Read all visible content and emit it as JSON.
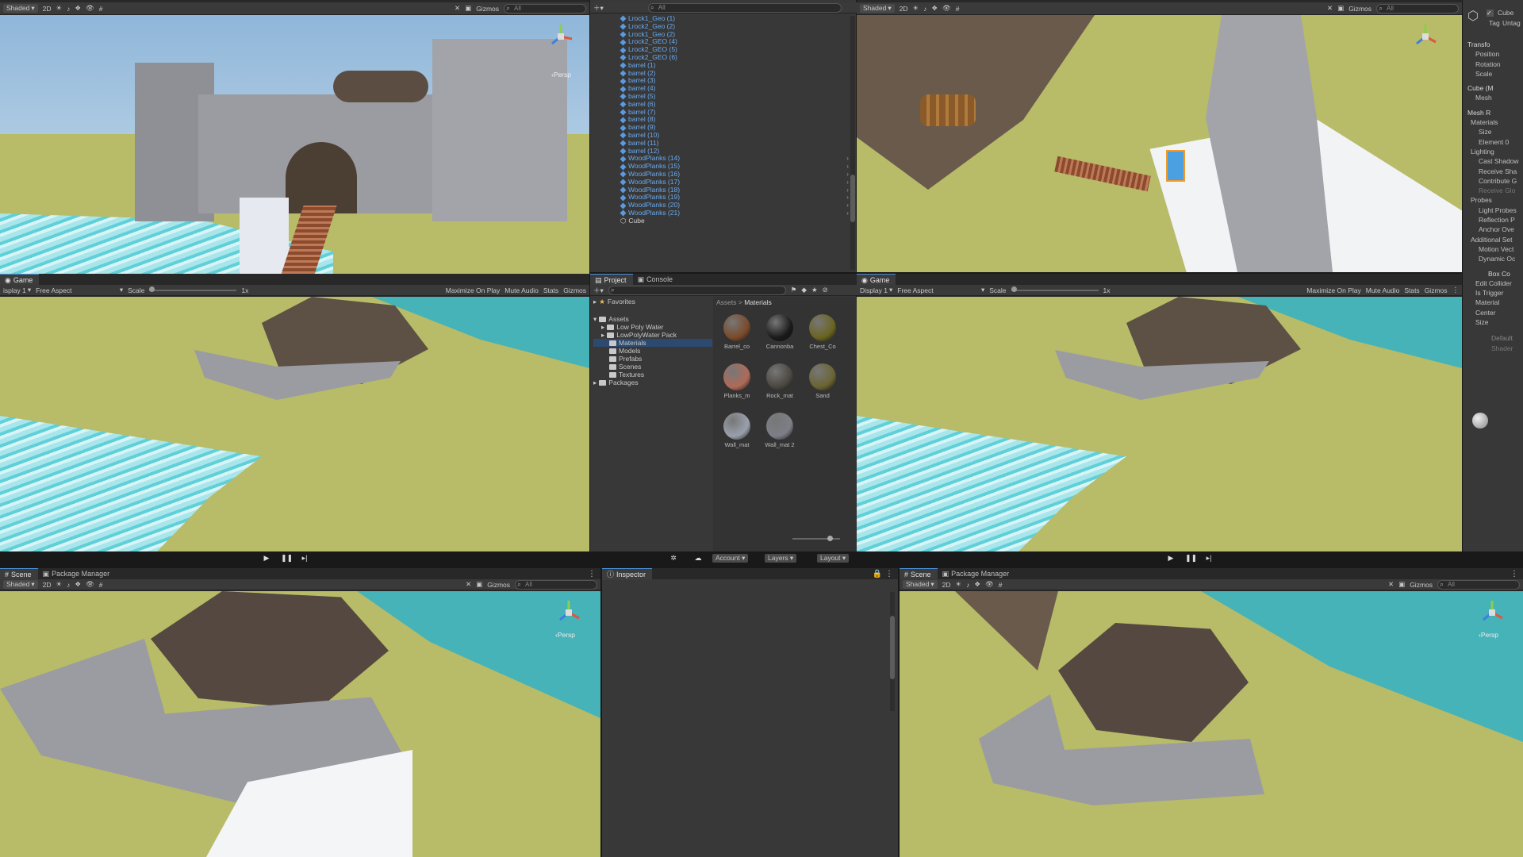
{
  "scene_toolbar": {
    "shading": "Shaded",
    "mode_2d": "2D",
    "gizmos": "Gizmos",
    "search_placeholder": "All",
    "persp": "‹Persp"
  },
  "scene_tabs": {
    "scene": "Scene",
    "package_manager": "Package Manager"
  },
  "game_toolbar": {
    "tab": "Game",
    "display": "Display 1",
    "aspect": "Free Aspect",
    "scale_label": "Scale",
    "scale_value": "1x",
    "maximize": "Maximize On Play",
    "mute": "Mute Audio",
    "stats": "Stats",
    "gizmos": "Gizmos"
  },
  "game_toolbar_left": {
    "display": "isplay 1"
  },
  "hierarchy": {
    "items": [
      "Lrock1_Geo (1)",
      "Lrock2_Geo (2)",
      "Lrock1_Geo (2)",
      "Lrock2_GEO (4)",
      "Lrock2_GEO (5)",
      "Lrock2_GEO (6)",
      "barrel (1)",
      "barrel (2)",
      "barrel (3)",
      "barrel (4)",
      "barrel (5)",
      "barrel (6)",
      "barrel (7)",
      "barrel (8)",
      "barrel (9)",
      "barrel (10)",
      "barrel (11)",
      "barrel (12)",
      "WoodPlanks (14)",
      "WoodPlanks (15)",
      "WoodPlanks (16)",
      "WoodPlanks (17)",
      "WoodPlanks (18)",
      "WoodPlanks (19)",
      "WoodPlanks (20)",
      "WoodPlanks (21)"
    ],
    "selected": "Cube",
    "search_placeholder": "All"
  },
  "project": {
    "tab_project": "Project",
    "tab_console": "Console",
    "favorites": "Favorites",
    "assets": "Assets",
    "tree": [
      "Low Poly Water",
      "LowPolyWater Pack",
      "Materials",
      "Models",
      "Prefabs",
      "Scenes",
      "Textures"
    ],
    "packages": "Packages",
    "breadcrumb_root": "Assets",
    "breadcrumb_sep": ">",
    "breadcrumb_current": "Materials",
    "materials": [
      "Barrel_co",
      "Cannonba",
      "Chest_Co",
      "Planks_m",
      "Rock_mat",
      "Sand",
      "Wall_mat",
      "Wall_mat 2"
    ],
    "material_colors": [
      "#7a4a2a",
      "#1a1a1a",
      "#6a6420",
      "#b06a58",
      "#4a4640",
      "#6a6432",
      "#9aa0ac",
      "#7d7f88"
    ]
  },
  "play_bar": {
    "account": "Account",
    "layers": "Layers",
    "layout": "Layout"
  },
  "inspector": {
    "tab": "Inspector",
    "object_name": "Cube",
    "tag_label": "Tag",
    "tag_value": "Untag",
    "rows": [
      {
        "text": "Transfo",
        "head": true
      },
      {
        "text": "Position",
        "head": false
      },
      {
        "text": "Rotation",
        "head": false
      },
      {
        "text": "Scale",
        "head": false
      },
      {
        "text": "Cube (M",
        "head": true
      },
      {
        "text": "Mesh",
        "head": false
      },
      {
        "text": "Mesh R",
        "head": true
      },
      {
        "text": "Materials",
        "head": false
      },
      {
        "text": "Size",
        "head": false
      },
      {
        "text": "Element 0",
        "head": false
      },
      {
        "text": "Lighting",
        "head": false
      },
      {
        "text": "Cast Shadow",
        "head": false
      },
      {
        "text": "Receive Sha",
        "head": false
      },
      {
        "text": "Contribute G",
        "head": false
      },
      {
        "text": "Receive Glo",
        "head": false
      },
      {
        "text": "Probes",
        "head": false
      },
      {
        "text": "Light Probes",
        "head": false
      },
      {
        "text": "Reflection P",
        "head": false
      },
      {
        "text": "Anchor Ove",
        "head": false
      },
      {
        "text": "Additional Set",
        "head": false
      },
      {
        "text": "Motion Vect",
        "head": false
      },
      {
        "text": "Dynamic Oc",
        "head": false
      },
      {
        "text": "Box Co",
        "head": true
      },
      {
        "text": "Edit Collider",
        "head": false
      },
      {
        "text": "Is Trigger",
        "head": false
      },
      {
        "text": "Material",
        "head": false
      },
      {
        "text": "Center",
        "head": false
      },
      {
        "text": "Size",
        "head": false
      },
      {
        "text": "Default",
        "head": false
      },
      {
        "text": "Shader",
        "head": false
      }
    ]
  },
  "bottom_tabs": {
    "inspector": "Inspector",
    "persp_label": "‹Persp"
  },
  "colors": {
    "accent": "#4a90d9",
    "link": "#6aaaf0"
  }
}
